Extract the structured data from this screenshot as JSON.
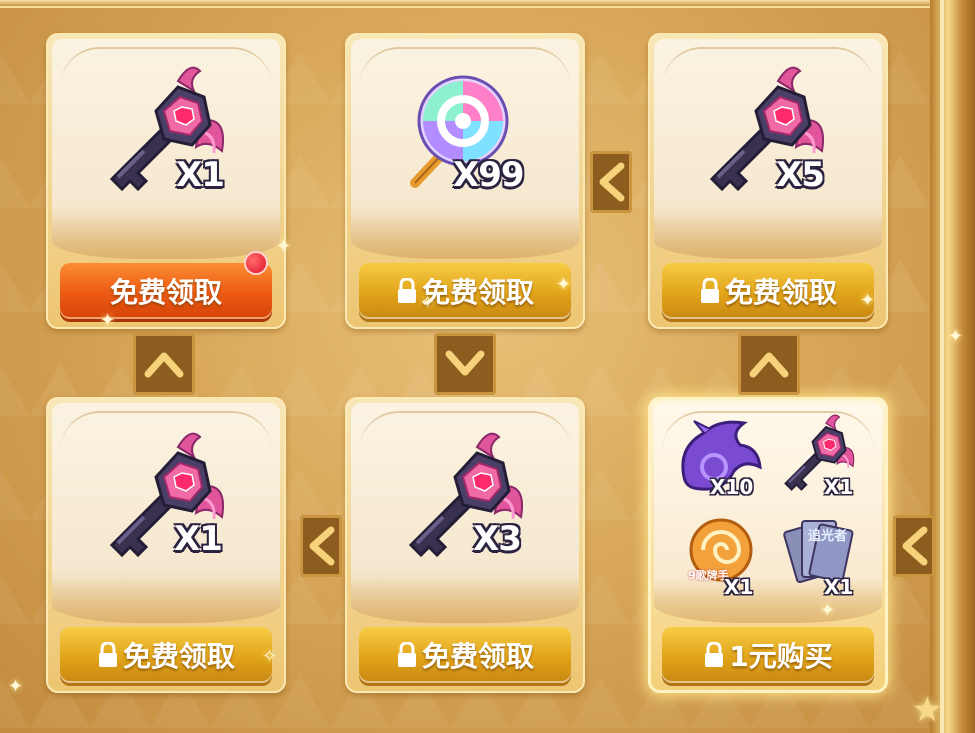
{
  "colors": {
    "gold_button": "#e1a419",
    "red_button": "#ec5a14",
    "frame": "#c9953f"
  },
  "cards": [
    {
      "id": "1",
      "item": "key-icon",
      "count": "X1",
      "button": "免费领取",
      "locked": false,
      "badge": "red-dot"
    },
    {
      "id": "2",
      "item": "lollipop-icon",
      "count": "X99",
      "button": "免费领取",
      "locked": true
    },
    {
      "id": "3",
      "item": "key-icon",
      "count": "X5",
      "button": "免费领取",
      "locked": true
    },
    {
      "id": "4",
      "item": "key-icon",
      "count": "X1",
      "button": "免费领取",
      "locked": true
    },
    {
      "id": "5",
      "item": "key-icon",
      "count": "X3",
      "button": "免费领取",
      "locked": true
    },
    {
      "id": "6",
      "items": [
        {
          "icon": "dragon-icon",
          "count": "X10"
        },
        {
          "icon": "key-icon",
          "count": "X1"
        },
        {
          "icon": "orb-icon",
          "count": "X1",
          "label": "9歌牌手"
        },
        {
          "icon": "card-pack-icon",
          "count": "X1",
          "label": "追光者"
        }
      ],
      "button": "1元购买",
      "locked": true
    }
  ],
  "connectors": [
    {
      "direction": "up"
    },
    {
      "direction": "down"
    },
    {
      "direction": "up"
    },
    {
      "direction": "left"
    },
    {
      "direction": "left"
    },
    {
      "direction": "left"
    }
  ]
}
